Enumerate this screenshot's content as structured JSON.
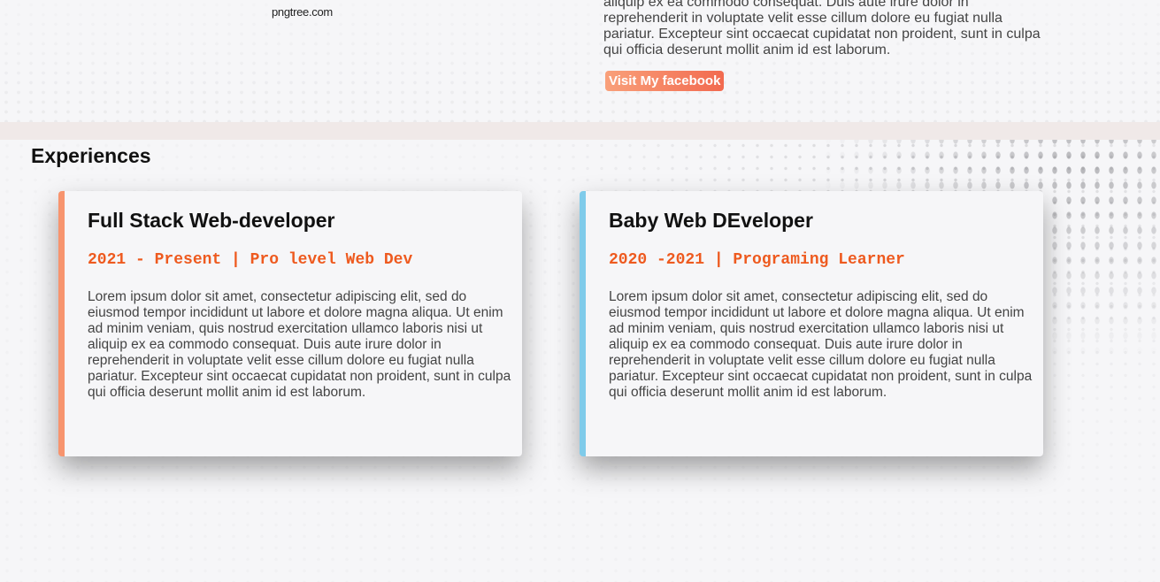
{
  "about": {
    "watermark": "pngtree.com",
    "text": "aliquip ex ea commodo consequat. Duis aute irure dolor in reprehenderit in voluptate velit esse cillum dolore eu fugiat nulla pariatur. Excepteur sint occaecat cupidatat non proident, sunt in culpa qui officia deserunt mollit anim id est laborum.",
    "button_label": "Visit My facebook"
  },
  "experiences": {
    "title": "Experiences",
    "items": [
      {
        "title": "Full Stack Web-developer",
        "period": "2021 - Present | Pro level Web Dev",
        "description": "Lorem ipsum dolor sit amet, consectetur adipiscing elit, sed do eiusmod tempor incididunt ut labore et dolore magna aliqua. Ut enim ad minim veniam, quis nostrud exercitation ullamco laboris nisi ut aliquip ex ea commodo consequat. Duis aute irure dolor in reprehenderit in voluptate velit esse cillum dolore eu fugiat nulla pariatur. Excepteur sint occaecat cupidatat non proident, sunt in culpa qui officia deserunt mollit anim id est laborum.",
        "accent_color": "#f7946e"
      },
      {
        "title": "Baby Web DEveloper",
        "period": "2020 -2021 | Programing Learner",
        "description": "Lorem ipsum dolor sit amet, consectetur adipiscing elit, sed do eiusmod tempor incididunt ut labore et dolore magna aliqua. Ut enim ad minim veniam, quis nostrud exercitation ullamco laboris nisi ut aliquip ex ea commodo consequat. Duis aute irure dolor in reprehenderit in voluptate velit esse cillum dolore eu fugiat nulla pariatur. Excepteur sint occaecat cupidatat non proident, sunt in culpa qui officia deserunt mollit anim id est laborum.",
        "accent_color": "#7fcbea"
      }
    ]
  },
  "colors": {
    "background": "#f6f6f8",
    "period_text": "#ee5a1f",
    "button_gradient_start": "#f9a07a",
    "button_gradient_end": "#f26a4f",
    "divider": "#f0e9e8"
  }
}
